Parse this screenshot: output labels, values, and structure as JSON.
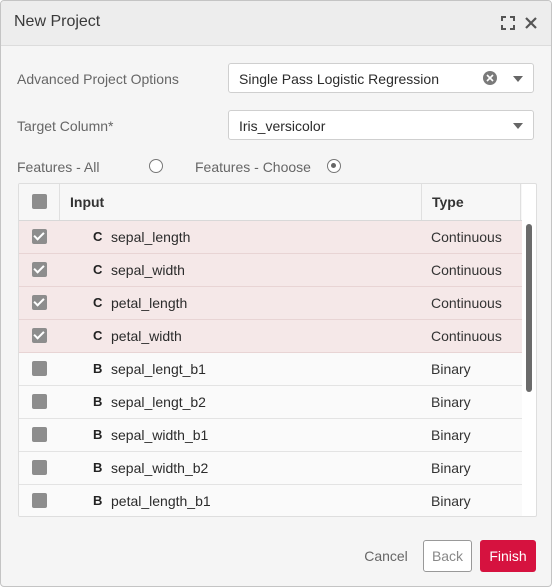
{
  "dialog": {
    "title": "New Project",
    "icons": [
      "expand-icon",
      "close-icon"
    ]
  },
  "form": {
    "advanced_label": "Advanced Project Options",
    "advanced_value": "Single Pass Logistic Regression",
    "target_label": "Target Column*",
    "target_value": "Iris_versicolor",
    "features_all_label": "Features - All",
    "features_choose_label": "Features - Choose",
    "features_selected": "choose"
  },
  "table": {
    "headers": {
      "input": "Input",
      "type": "Type"
    },
    "rows": [
      {
        "checked": true,
        "kind": "C",
        "name": "sepal_length",
        "type": "Continuous"
      },
      {
        "checked": true,
        "kind": "C",
        "name": "sepal_width",
        "type": "Continuous"
      },
      {
        "checked": true,
        "kind": "C",
        "name": "petal_length",
        "type": "Continuous"
      },
      {
        "checked": true,
        "kind": "C",
        "name": "petal_width",
        "type": "Continuous"
      },
      {
        "checked": false,
        "kind": "B",
        "name": "sepal_lengt_b1",
        "type": "Binary"
      },
      {
        "checked": false,
        "kind": "B",
        "name": "sepal_lengt_b2",
        "type": "Binary"
      },
      {
        "checked": false,
        "kind": "B",
        "name": "sepal_width_b1",
        "type": "Binary"
      },
      {
        "checked": false,
        "kind": "B",
        "name": "sepal_width_b2",
        "type": "Binary"
      },
      {
        "checked": false,
        "kind": "B",
        "name": "petal_length_b1",
        "type": "Binary"
      }
    ]
  },
  "footer": {
    "cancel": "Cancel",
    "back": "Back",
    "finish": "Finish"
  },
  "colors": {
    "accent": "#d6123f",
    "selected_row": "#f5e8e8"
  }
}
